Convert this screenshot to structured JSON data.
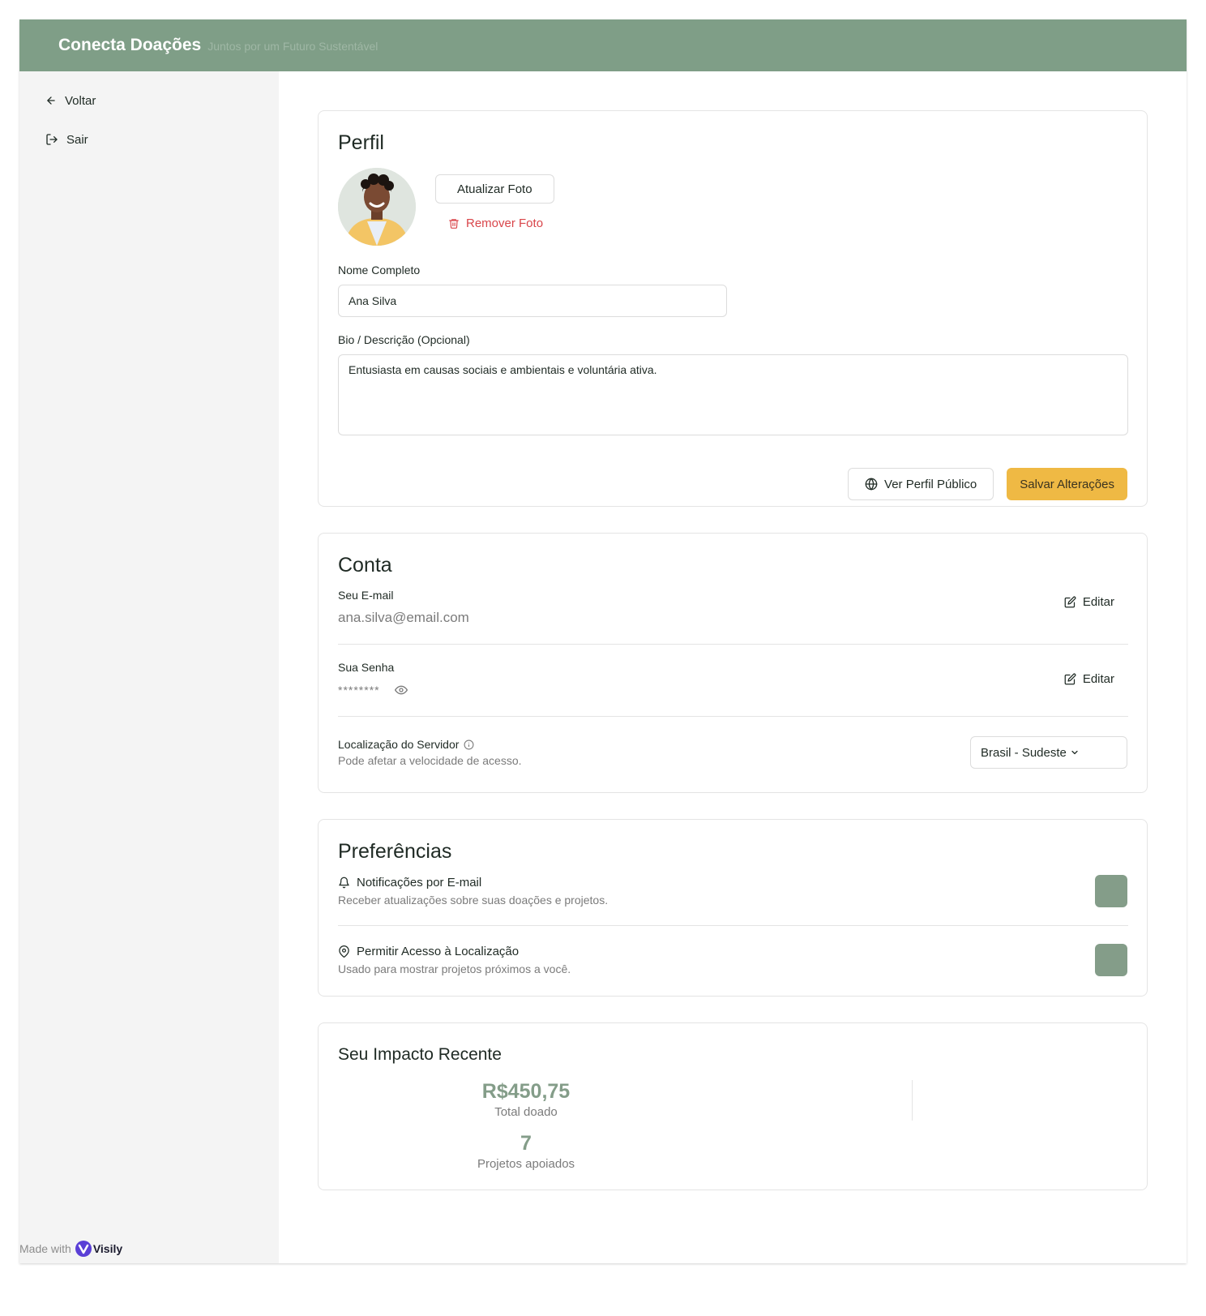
{
  "header": {
    "brand": "Conecta Doações",
    "tagline": "Juntos por um Futuro Sustentável"
  },
  "sidebar": {
    "items": [
      {
        "label": "Voltar",
        "icon": "arrow-left-icon"
      },
      {
        "label": "Sair",
        "icon": "logout-icon"
      }
    ]
  },
  "profile": {
    "title": "Perfil",
    "update_photo": "Atualizar Foto",
    "remove_photo": "Remover Foto",
    "name_label": "Nome Completo",
    "name_value": "Ana Silva",
    "bio_label": "Bio / Descrição (Opcional)",
    "bio_value": "Entusiasta em causas sociais e ambientais e voluntária ativa.",
    "public_profile_button": "Ver Perfil Público",
    "save_button": "Salvar Alterações"
  },
  "account": {
    "title": "Conta",
    "email_label": "Seu E-mail",
    "email_value": "ana.silva@email.com",
    "password_label": "Sua Senha",
    "password_value": "********",
    "edit_label": "Editar",
    "server_label": "Localização do Servidor",
    "server_sub": "Pode afetar a velocidade de acesso.",
    "server_value": "Brasil - Sudeste"
  },
  "preferences": {
    "title": "Preferências",
    "items": [
      {
        "label": "Notificações por E-mail",
        "sub": "Receber atualizações sobre suas doações e projetos.",
        "icon": "bell-icon"
      },
      {
        "label": "Permitir Acesso à Localização",
        "sub": "Usado para mostrar projetos próximos a você.",
        "icon": "map-pin-icon"
      }
    ]
  },
  "impact": {
    "title": "Seu Impacto Recente",
    "total_value": "R$450,75",
    "total_label": "Total doado",
    "projects_value": "7",
    "projects_label": "Projetos apoiados"
  },
  "footer": {
    "made_with": "Made with",
    "brand": "Visily"
  },
  "colors": {
    "primary": "#7f9e87",
    "accent": "#efb944",
    "danger": "#d9454a"
  }
}
